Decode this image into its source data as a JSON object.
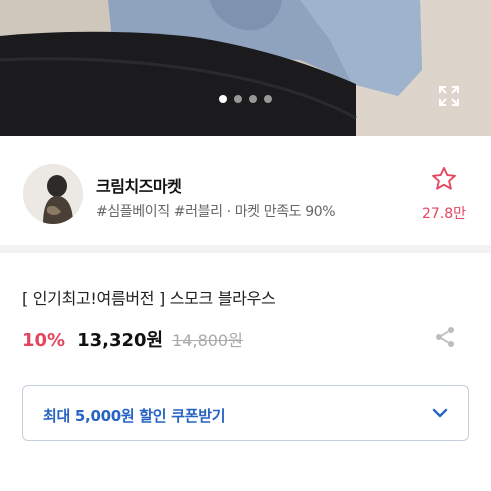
{
  "gallery": {
    "slides_total": 4,
    "active_slide": 1
  },
  "seller": {
    "name": "크림치즈마켓",
    "tags": "#심플베이직 #러블리 · 마켓 만족도 90%",
    "fav_count": "27.8만"
  },
  "product": {
    "title": "[ 인기최고!여름버전 ] 스모크 블라우스",
    "discount": "10%",
    "price": "13,320원",
    "original_price": "14,800원"
  },
  "coupon": {
    "label": "최대 5,000원 할인 쿠폰받기"
  },
  "icons": {
    "expand": "expand-icon",
    "favorite": "star-outline-icon",
    "share": "share-icon",
    "coupon_toggle": "chevron-down-icon"
  },
  "colors": {
    "accent_red": "#e5465f",
    "coupon_blue": "#2764c4",
    "divider": "#f2f2f2"
  }
}
